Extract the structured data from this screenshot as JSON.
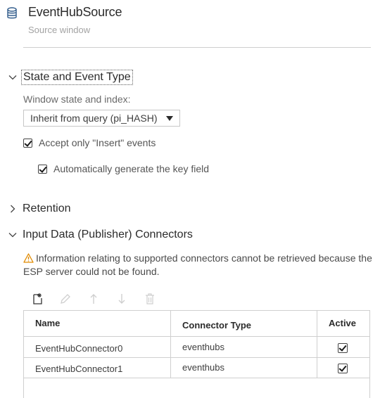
{
  "header": {
    "title": "EventHubSource",
    "subtitle": "Source window",
    "icon": "database-icon"
  },
  "sections": {
    "state": {
      "label": "State and Event Type",
      "expanded": true
    },
    "retention": {
      "label": "Retention",
      "expanded": false
    },
    "connectors": {
      "label": "Input Data (Publisher) Connectors",
      "expanded": true
    }
  },
  "state": {
    "window_state_label": "Window state and index:",
    "window_state_value": "Inherit from query (pi_HASH)",
    "accept_insert_label": "Accept only \"Insert\" events",
    "accept_insert_checked": true,
    "auto_key_label": "Automatically generate the key field",
    "auto_key_checked": true
  },
  "connectors": {
    "warning": "Information relating to supported connectors cannot be retrieved because the ESP server could not be found.",
    "toolbar": [
      "add-icon",
      "edit-icon",
      "move-up-icon",
      "move-down-icon",
      "delete-icon"
    ],
    "columns": [
      "Name",
      "Connector Type",
      "Active"
    ],
    "rows": [
      {
        "name": "EventHubConnector0",
        "type": "eventhubs",
        "active": true
      },
      {
        "name": "EventHubConnector1",
        "type": "eventhubs",
        "active": true
      }
    ]
  },
  "colors": {
    "text": "#3d3d3d",
    "muted": "#a3a3a3",
    "border": "#cfcfcf",
    "warning": "#e08a00"
  }
}
